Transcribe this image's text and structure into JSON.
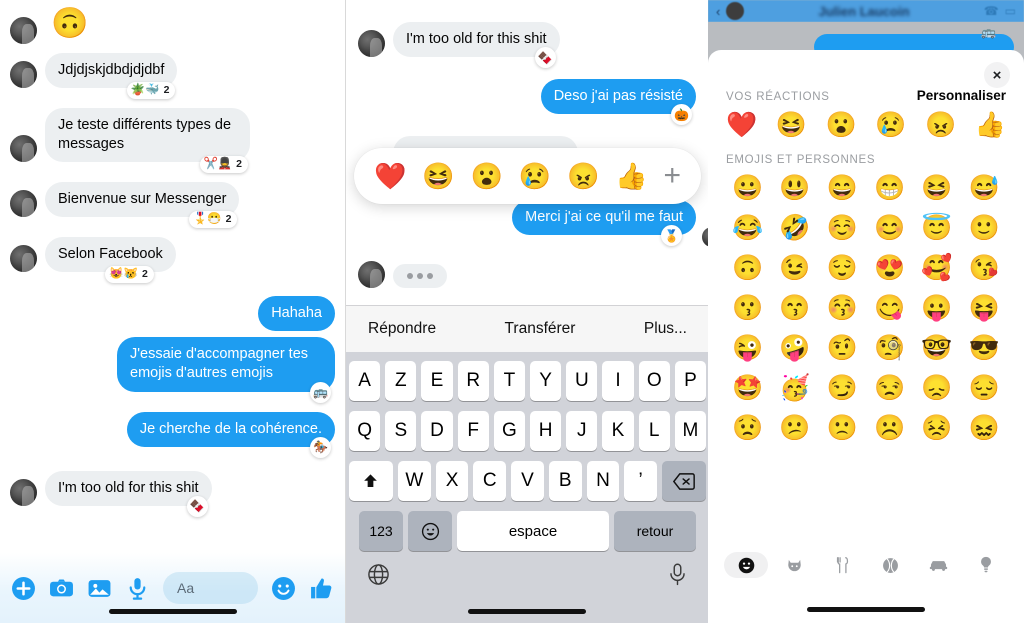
{
  "left_panel": {
    "messages": [
      {
        "side": "in",
        "type": "emoji",
        "text": "🙃",
        "reaction": null
      },
      {
        "side": "in",
        "type": "text",
        "text": "Jdjdjskjdbdjdjdbf",
        "reaction": {
          "emojis": "🪴🐳",
          "count": "2"
        }
      },
      {
        "side": "in",
        "type": "text",
        "text": "Je teste différents types de messages",
        "reaction": {
          "emojis": "✂️💂",
          "count": "2"
        }
      },
      {
        "side": "in",
        "type": "text",
        "text": "Bienvenue sur Messenger",
        "reaction": {
          "emojis": "🎖️😷",
          "count": "2"
        }
      },
      {
        "side": "in",
        "type": "text",
        "text": "Selon Facebook",
        "reaction": {
          "emojis": "😻😿",
          "count": "2"
        }
      },
      {
        "side": "out",
        "type": "text",
        "text": "Hahaha",
        "reaction": null
      },
      {
        "side": "out",
        "type": "text",
        "text": "J'essaie d'accompagner tes emojis d'autres emojis",
        "reaction_single": "🚌"
      },
      {
        "side": "out",
        "type": "text",
        "text": "Je cherche de la cohérence.",
        "reaction_single": "🏇"
      },
      {
        "side": "in",
        "type": "text",
        "text": "I'm too old for this shit",
        "reaction_single": "🍫"
      }
    ],
    "composer": {
      "placeholder": "Aa",
      "icons": [
        "plus-circle-icon",
        "camera-icon",
        "photo-icon",
        "microphone-icon",
        "smiley-icon",
        "thumbs-up-icon"
      ]
    }
  },
  "mid_panel": {
    "messages": [
      {
        "side": "in",
        "text": "I'm too old for this shit",
        "reaction_single": "🍫"
      },
      {
        "side": "out",
        "text": "Deso j'ai pas résisté",
        "reaction_single": "🎃"
      },
      {
        "side": "out",
        "text": "Merci j'ai ce qu'il me faut",
        "reaction_single": "🏅"
      }
    ],
    "reaction_bar": {
      "emojis": [
        "❤️",
        "😆",
        "😮",
        "😢",
        "😠",
        "👍"
      ],
      "add_label": "+"
    },
    "typing_indicator": "•••",
    "action_bar": {
      "reply": "Répondre",
      "forward": "Transférer",
      "more": "Plus..."
    },
    "keyboard": {
      "row1": [
        "A",
        "Z",
        "E",
        "R",
        "T",
        "Y",
        "U",
        "I",
        "O",
        "P"
      ],
      "row2": [
        "Q",
        "S",
        "D",
        "F",
        "G",
        "H",
        "J",
        "K",
        "L",
        "M"
      ],
      "row3": [
        "W",
        "X",
        "C",
        "V",
        "B",
        "N",
        "’"
      ],
      "shift_key": "shift-icon",
      "backspace_key": "backspace-icon",
      "numeric_key": "123",
      "emoji_key": "emoji-keyboard-icon",
      "space_key": "espace",
      "return_key": "retour",
      "globe_key": "globe-icon",
      "dictation_key": "microphone-icon"
    }
  },
  "right_panel": {
    "nav_title": "Julien Laucoin",
    "close_label": "×",
    "your_reactions_title": "VOS RÉACTIONS",
    "customize_label": "Personnaliser",
    "favorites": [
      "❤️",
      "😆",
      "😮",
      "😢",
      "😠",
      "👍"
    ],
    "emojis_section_title": "EMOJIS ET PERSONNES",
    "emoji_grid": [
      "😀",
      "😃",
      "😄",
      "😁",
      "😆",
      "😅",
      "😂",
      "🤣",
      "☺️",
      "😊",
      "😇",
      "🙂",
      "🙃",
      "😉",
      "😌",
      "😍",
      "🥰",
      "😘",
      "😗",
      "😙",
      "😚",
      "😋",
      "😛",
      "😝",
      "😜",
      "🤪",
      "🤨",
      "🧐",
      "🤓",
      "😎",
      "🤩",
      "🥳",
      "😏",
      "😒",
      "😞",
      "😔",
      "😟",
      "😕",
      "🙁",
      "☹️",
      "😣",
      "😖"
    ],
    "categories": [
      {
        "name": "smileys-category",
        "icon": "smiley-icon",
        "active": true
      },
      {
        "name": "animals-category",
        "icon": "cat-icon",
        "active": false
      },
      {
        "name": "food-category",
        "icon": "fork-knife-icon",
        "active": false
      },
      {
        "name": "activity-category",
        "icon": "ball-icon",
        "active": false
      },
      {
        "name": "travel-category",
        "icon": "car-icon",
        "active": false
      },
      {
        "name": "objects-category",
        "icon": "lightbulb-icon",
        "active": false
      }
    ]
  },
  "colors": {
    "outgoing_bubble": "#1e9df1",
    "incoming_bubble": "#eceff1",
    "accent": "#1e9df1",
    "keyboard_bg": "#d1d3d9"
  }
}
